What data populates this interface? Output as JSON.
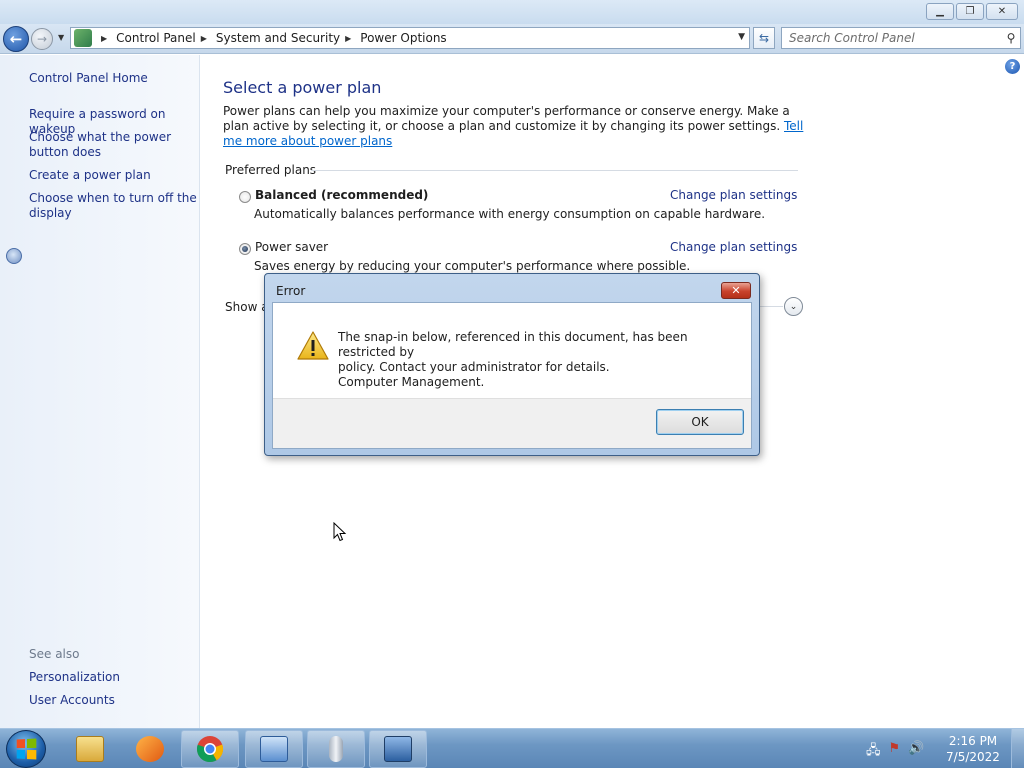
{
  "window": {
    "minimize_icon": "minimize-icon",
    "maximize_icon": "restore-icon",
    "close_icon": "close-icon"
  },
  "navbar": {
    "breadcrumbs": [
      "Control Panel",
      "System and Security",
      "Power Options"
    ],
    "search_placeholder": "Search Control Panel"
  },
  "sidebar": {
    "home": "Control Panel Home",
    "links": [
      "Require a password on wakeup",
      "Choose what the power button does",
      "Create a power plan",
      "Choose when to turn off the display"
    ],
    "see_also_label": "See also",
    "see_also": [
      "Personalization",
      "User Accounts"
    ]
  },
  "main": {
    "title": "Select a power plan",
    "intro_text": "Power plans can help you maximize your computer's performance or conserve energy. Make a plan active by selecting it, or choose a plan and customize it by changing its power settings. ",
    "intro_link": "Tell me more about power plans",
    "section_label": "Preferred plans",
    "plans": [
      {
        "name": "Balanced (recommended)",
        "description": "Automatically balances performance with energy consumption on capable hardware.",
        "link": "Change plan settings",
        "selected": false
      },
      {
        "name": "Power saver",
        "description": "Saves energy by reducing your computer's performance where possible.",
        "link": "Change plan settings",
        "selected": true
      }
    ],
    "show_more_label": "Show a"
  },
  "dialog": {
    "title": "Error",
    "close_label": "✕",
    "message_lines": [
      "The snap-in below, referenced in this document, has been restricted by",
      "policy. Contact your administrator for details.",
      "Computer Management."
    ],
    "ok_label": "OK"
  },
  "taskbar": {
    "items": [
      "start-button",
      "windows-explorer",
      "media-player",
      "google-chrome",
      "control-panel",
      "microphone-app",
      "remote-desktop"
    ],
    "clock_time": "2:16 PM",
    "clock_date": "7/5/2022"
  },
  "colors": {
    "link": "#1e3287",
    "hyperlink": "#0066cc",
    "sidebar_bg": "#e9f0f9",
    "taskbar": "#6d97c3",
    "dialog_frame": "#c2d6ed"
  }
}
